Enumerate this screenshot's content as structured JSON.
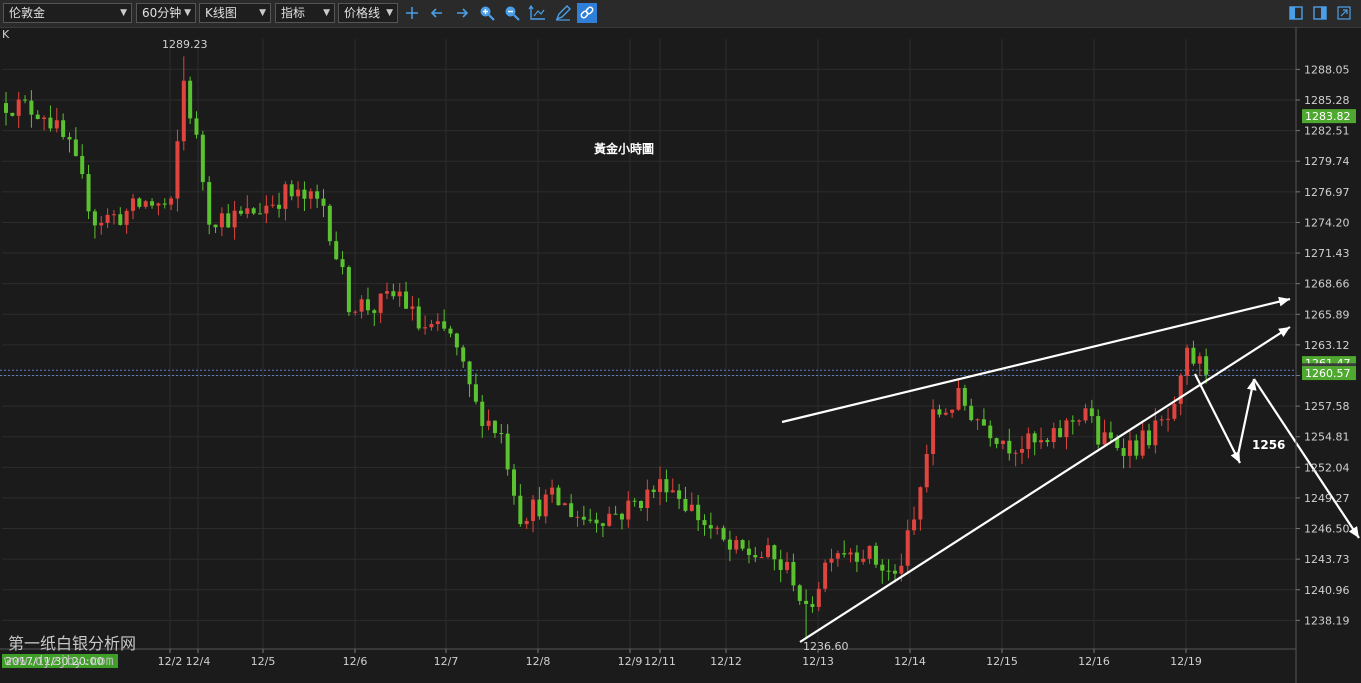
{
  "toolbar": {
    "symbol": "伦敦金",
    "period": "60分钟",
    "chart_type": "K线图",
    "indicator": "指标",
    "price_line": "价格线",
    "icons": [
      "crosshair-icon",
      "arrow-left-icon",
      "arrow-right-icon",
      "zoom-in-icon",
      "zoom-out-icon",
      "axis-icon",
      "pen-icon",
      "link-icon"
    ],
    "right_icons": [
      "panel-left-icon",
      "panel-right-icon",
      "maximize-icon"
    ]
  },
  "chart_data": {
    "type": "candlestick",
    "corner_label": "K",
    "title": "黃金小時圖",
    "y_ticks": [
      1288.05,
      1285.28,
      1282.51,
      1279.74,
      1276.97,
      1274.2,
      1271.43,
      1268.66,
      1265.89,
      1263.12,
      1260.35,
      1257.58,
      1254.81,
      1252.04,
      1249.27,
      1246.5,
      1243.73,
      1240.96,
      1238.19
    ],
    "ylim": [
      1235.6,
      1290.8
    ],
    "x_labels": [
      "12/2",
      "12/4",
      "12/5",
      "12/6",
      "12/7",
      "12/8",
      "12/9",
      "12/11",
      "12/12",
      "12/13",
      "12/14",
      "12/15",
      "12/16",
      "12/19"
    ],
    "x_start_label": "2017/11/30 20:00",
    "high_label": "1289.23",
    "low_label": "1236.60",
    "price_tags": [
      {
        "text": "1283.82",
        "value": 1283.82,
        "color": "#4fa82f"
      },
      {
        "text": "1261.47",
        "value": 1261.47,
        "color": "#4fa82f"
      },
      {
        "text": "1260.82",
        "value": 1260.82,
        "color": "#3a3a3a"
      },
      {
        "text": "1260.57",
        "value": 1260.57,
        "color": "#4fa82f"
      }
    ],
    "reference_lines": [
      1260.82,
      1260.35
    ],
    "annotation": "1256",
    "path": [
      [
        0,
        1285.0
      ],
      [
        6,
        1284.2
      ],
      [
        10,
        1280.8
      ],
      [
        14,
        1274.5
      ],
      [
        18,
        1274.8
      ],
      [
        22,
        1276.0
      ],
      [
        26,
        1275.5
      ],
      [
        28,
        1287.0
      ],
      [
        30,
        1281.5
      ],
      [
        32,
        1274.8
      ],
      [
        37,
        1274.6
      ],
      [
        40,
        1275.5
      ],
      [
        44,
        1276.8
      ],
      [
        50,
        1275.8
      ],
      [
        54,
        1267.0
      ],
      [
        58,
        1266.5
      ],
      [
        62,
        1267.8
      ],
      [
        65,
        1264.8
      ],
      [
        70,
        1264.0
      ],
      [
        74,
        1257.5
      ],
      [
        78,
        1255.0
      ],
      [
        81,
        1247.8
      ],
      [
        86,
        1249.2
      ],
      [
        91,
        1247.4
      ],
      [
        97,
        1248.0
      ],
      [
        104,
        1250.8
      ],
      [
        110,
        1247.0
      ],
      [
        114,
        1244.5
      ],
      [
        120,
        1244.0
      ],
      [
        124,
        1242.2
      ],
      [
        126,
        1238.6
      ],
      [
        130,
        1244.8
      ],
      [
        135,
        1244.5
      ],
      [
        140,
        1242.0
      ],
      [
        143,
        1247.0
      ],
      [
        146,
        1256.5
      ],
      [
        150,
        1258.2
      ],
      [
        154,
        1256.0
      ],
      [
        158,
        1254.2
      ],
      [
        164,
        1254.0
      ],
      [
        170,
        1257.5
      ],
      [
        172,
        1254.5
      ],
      [
        178,
        1254.0
      ],
      [
        184,
        1256.8
      ],
      [
        186,
        1262.0
      ],
      [
        189,
        1261.0
      ]
    ]
  }
}
